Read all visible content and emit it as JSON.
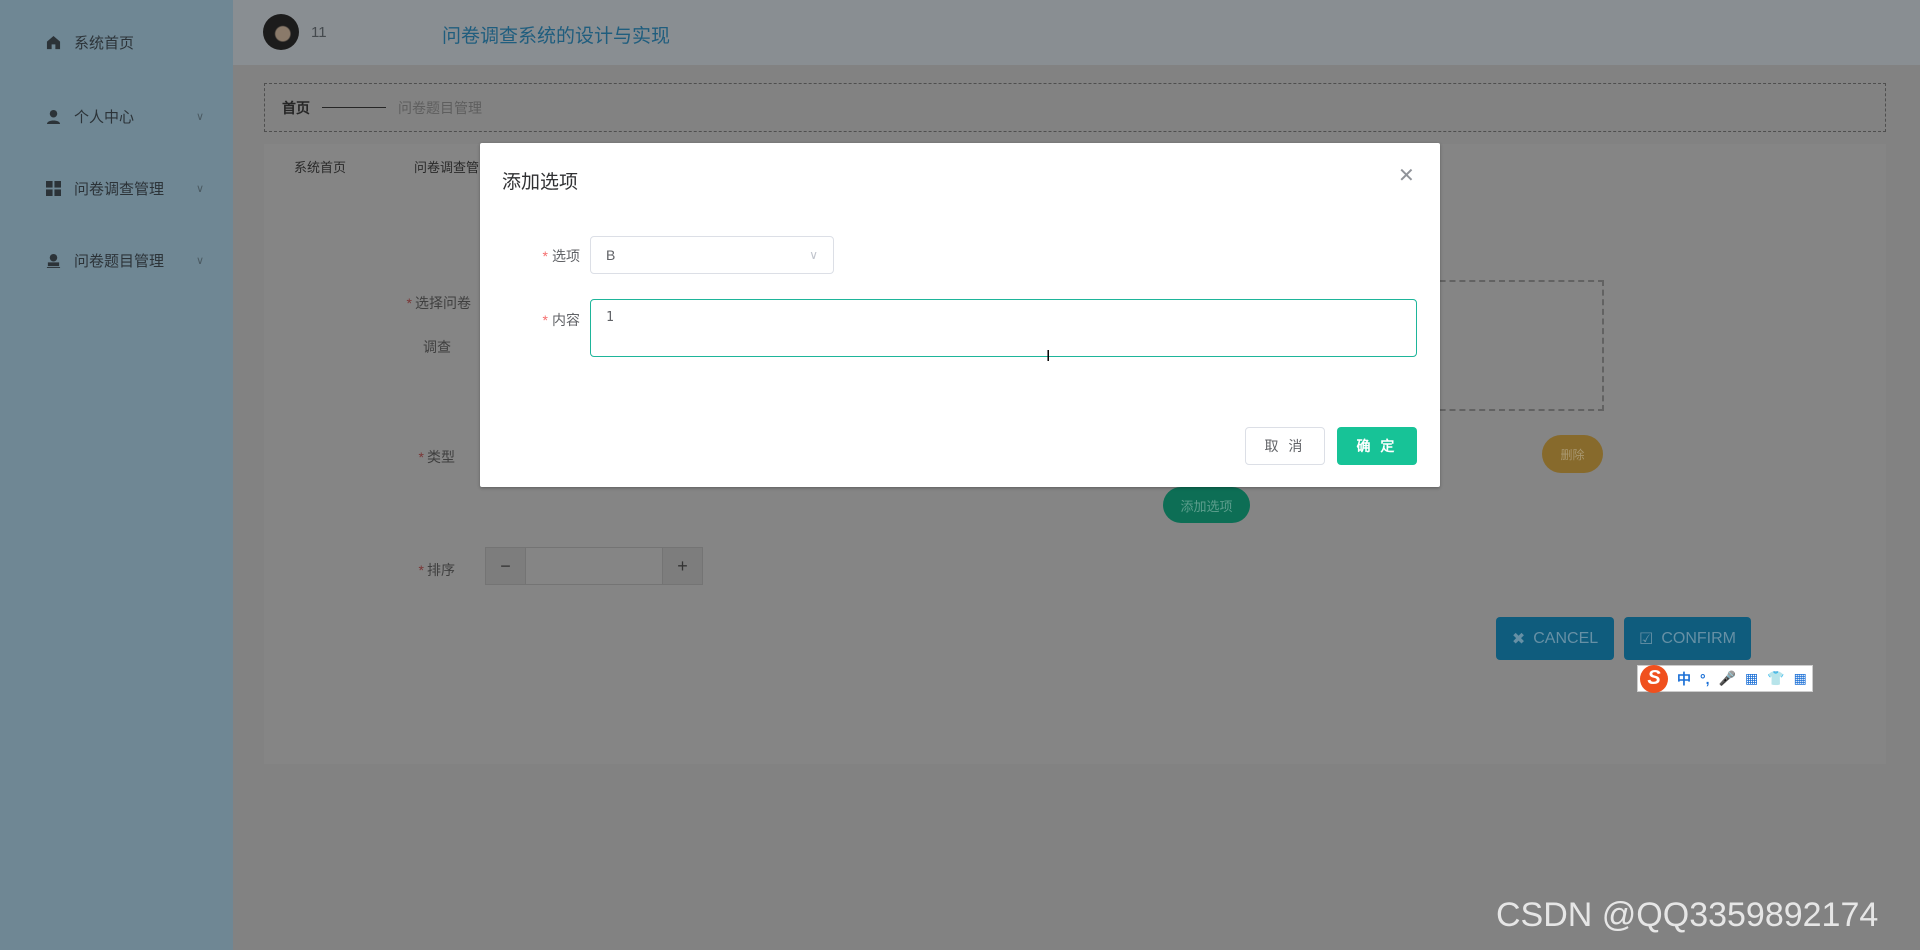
{
  "sidebar": {
    "items": [
      {
        "label": "系统首页",
        "icon": "home-icon"
      },
      {
        "label": "个人中心",
        "icon": "user-icon"
      },
      {
        "label": "问卷调查管理",
        "icon": "grid-icon"
      },
      {
        "label": "问卷题目管理",
        "icon": "stamp-user-icon"
      }
    ]
  },
  "header": {
    "username": "11",
    "title": "问卷调查系统的设计与实现"
  },
  "breadcrumb": {
    "home": "首页",
    "current": "问卷题目管理"
  },
  "tabs": [
    "系统首页",
    "问卷调查管"
  ],
  "form": {
    "survey_label": "选择问卷",
    "survey_label2": "调查",
    "type_label": "类型",
    "sort_label": "排序",
    "delete": "删除",
    "add_option": "添加选项",
    "cancel": "CANCEL",
    "confirm": "CONFIRM"
  },
  "modal": {
    "title": "添加选项",
    "option_label": "选项",
    "option_value": "B",
    "content_label": "内容",
    "content_value": "1",
    "cancel": "取 消",
    "ok": "确 定"
  },
  "ime": {
    "chinese": "中",
    "punct": "°,"
  },
  "watermark": "CSDN @QQ3359892174",
  "colors": {
    "accent": "#17c397",
    "cancel_confirm": "#0f5c7d",
    "delete": "#e6a23c"
  }
}
